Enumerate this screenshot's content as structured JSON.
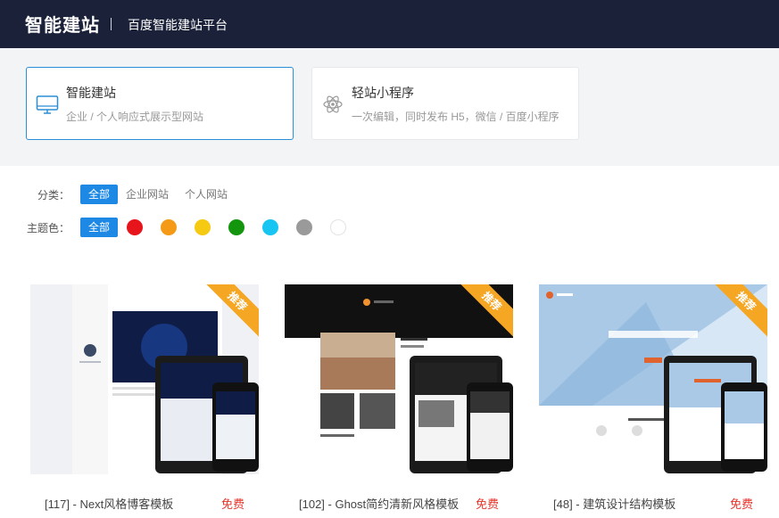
{
  "header": {
    "logo": "智能建站",
    "subtitle": "百度智能建站平台"
  },
  "products": [
    {
      "title": "智能建站",
      "desc": "企业 / 个人响应式展示型网站",
      "icon": "monitor-icon",
      "active": true
    },
    {
      "title": "轻站小程序",
      "desc": "一次编辑，同时发布 H5，微信 / 百度小程序",
      "icon": "atom-icon",
      "active": false
    }
  ],
  "filters": {
    "category_label": "分类：",
    "categories": [
      "全部",
      "企业网站",
      "个人网站"
    ],
    "color_label": "主题色：",
    "all_colors": "全部",
    "colors": [
      "#e8141b",
      "#f49a16",
      "#f6c913",
      "#13950d",
      "#16c5f2",
      "#9a9a9a",
      "#ffffff"
    ]
  },
  "templates": [
    {
      "name": "[117] - Next风格博客模板",
      "price": "免费",
      "badge": "推荐"
    },
    {
      "name": "[102] - Ghost简约清新风格模板",
      "price": "免费",
      "badge": "推荐"
    },
    {
      "name": "[48] - 建筑设计结构模板",
      "price": "免费",
      "badge": "推荐"
    }
  ],
  "colors": {
    "header_bg": "#1a2138",
    "accent": "#1e88e5",
    "ribbon": "#f5a623",
    "price": "#e5352b"
  }
}
